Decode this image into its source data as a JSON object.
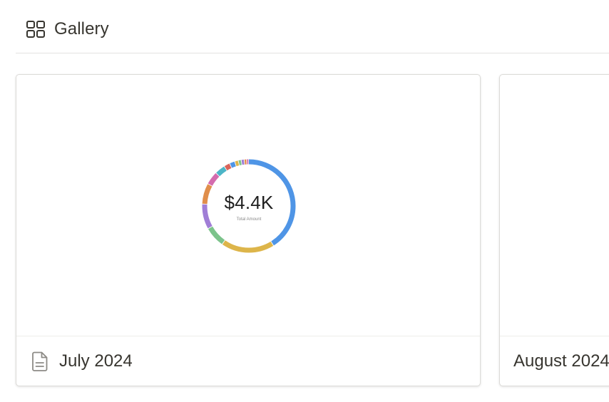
{
  "header": {
    "icon": "gallery-grid-icon",
    "title": "Gallery"
  },
  "cards": [
    {
      "title": "July 2024",
      "icon": "page-document-icon",
      "cover": {
        "total": "$4.4K",
        "caption": "Total Amount",
        "segments": [
          {
            "color": "#4f95e6",
            "value": 40
          },
          {
            "color": "#ddb54a",
            "value": 18
          },
          {
            "color": "#7cc38b",
            "value": 7
          },
          {
            "color": "#a07ed6",
            "value": 8.5
          },
          {
            "color": "#e08e4b",
            "value": 7
          },
          {
            "color": "#d46cae",
            "value": 4.5
          },
          {
            "color": "#4db5c7",
            "value": 3.5
          },
          {
            "color": "#d9645a",
            "value": 2
          },
          {
            "color": "#4f95e6",
            "value": 1.8
          },
          {
            "color": "#ddb54a",
            "value": 1.2
          },
          {
            "color": "#7cc38b",
            "value": 1
          },
          {
            "color": "#a07ed6",
            "value": 1
          },
          {
            "color": "#e08e4b",
            "value": 0.8
          },
          {
            "color": "#d46cae",
            "value": 0.7
          }
        ]
      }
    },
    {
      "title": "August 2024"
    }
  ]
}
